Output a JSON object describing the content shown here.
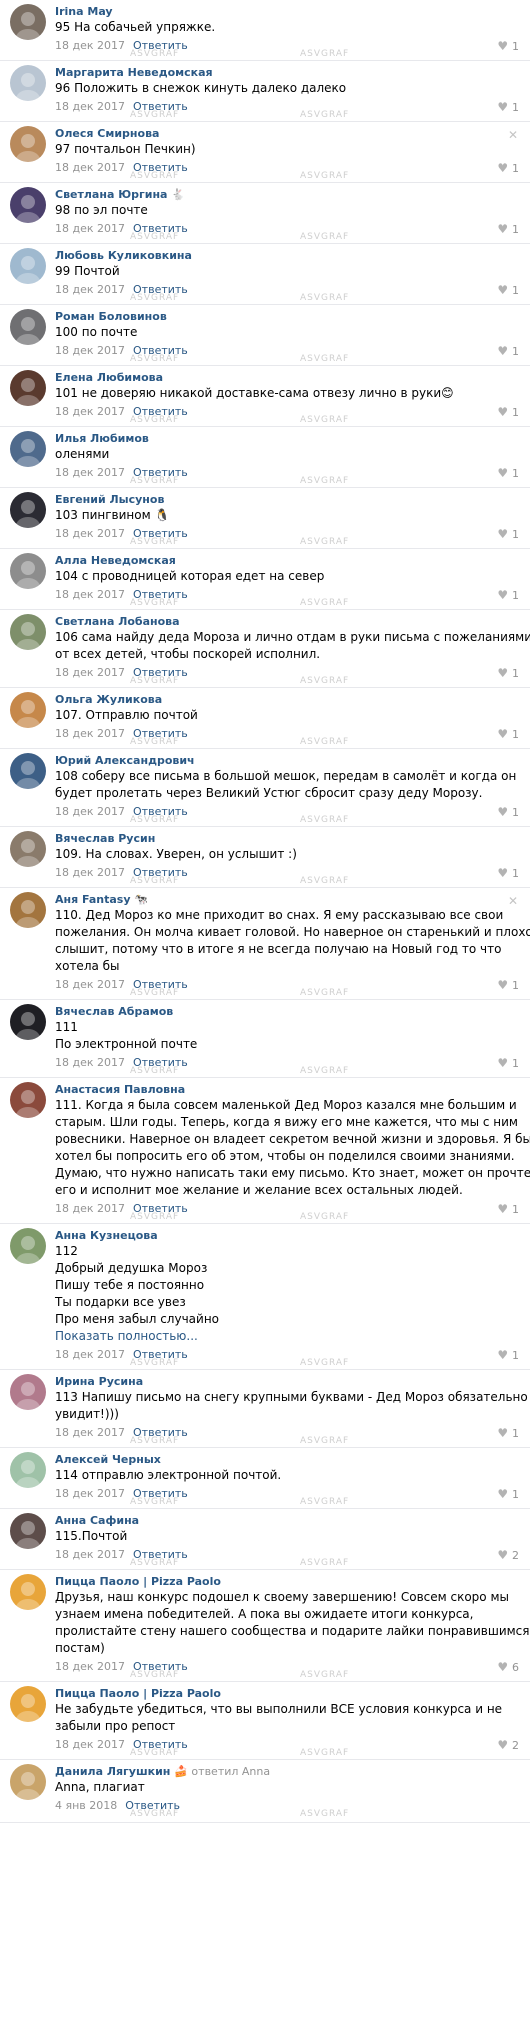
{
  "watermark": "ASVGRAF",
  "reply_label": "Ответить",
  "comments": [
    {
      "name": "Irina May",
      "lines": [
        "95 На собачьей упряжке."
      ],
      "date": "18 дек 2017",
      "likes": "1",
      "avatar": "#7a6e63"
    },
    {
      "name": "Маргарита Неведомская",
      "lines": [
        "96 Положить в снежок кинуть далеко далеко"
      ],
      "date": "18 дек 2017",
      "likes": "1",
      "avatar": "#b9c5d2"
    },
    {
      "name": "Олеся Смирнова",
      "lines": [
        "97 почтальон Печкин)"
      ],
      "date": "18 дек 2017",
      "likes": "1",
      "avatar": "#b98a5c",
      "close": true
    },
    {
      "name": "Светлана Юргина 🐇",
      "lines": [
        "98 по эл почте"
      ],
      "date": "18 дек 2017",
      "likes": "1",
      "avatar": "#4a3f6b"
    },
    {
      "name": "Любовь Куликовкина",
      "lines": [
        "99 Почтой"
      ],
      "date": "18 дек 2017",
      "likes": "1",
      "avatar": "#9fb9cf"
    },
    {
      "name": "Роман Боловинов",
      "lines": [
        "100 по почте"
      ],
      "date": "18 дек 2017",
      "likes": "1",
      "avatar": "#6f6f72"
    },
    {
      "name": "Елена Любимова",
      "lines": [
        "101 не доверяю никакой доставке-сама отвезу лично в руки😊"
      ],
      "date": "18 дек 2017",
      "likes": "1",
      "avatar": "#5a3a2e"
    },
    {
      "name": "Илья Любимов",
      "lines": [
        "оленями"
      ],
      "date": "18 дек 2017",
      "likes": "1",
      "avatar": "#4f6a8c"
    },
    {
      "name": "Евгений Лысунов",
      "lines": [
        "103 пингвином 🐧"
      ],
      "date": "18 дек 2017",
      "likes": "1",
      "avatar": "#2b2b33"
    },
    {
      "name": "Алла Неведомская",
      "lines": [
        "104 с проводницей которая едет на север"
      ],
      "date": "18 дек 2017",
      "likes": "1",
      "avatar": "#8d8d8d"
    },
    {
      "name": "Светлана Лобанова",
      "lines": [
        "106 сама найду деда Мороза и лично отдам в руки письма с пожеланиями",
        "от всех детей, чтобы поскорей исполнил."
      ],
      "date": "18 дек 2017",
      "likes": "1",
      "avatar": "#7e8f6a"
    },
    {
      "name": "Ольга Жуликова",
      "lines": [
        "107. Отправлю почтой"
      ],
      "date": "18 дек 2017",
      "likes": "1",
      "avatar": "#c6884a"
    },
    {
      "name": "Юрий Александрович",
      "lines": [
        "108 соберу все письма в большой мешок, передам в самолёт и когда он",
        "будет пролетать через Великий Устюг сбросит сразу деду Морозу."
      ],
      "date": "18 дек 2017",
      "likes": "1",
      "avatar": "#3d5f86"
    },
    {
      "name": "Вячеслав Русин",
      "lines": [
        "109. На словах. Уверен, он услышит :)"
      ],
      "date": "18 дек 2017",
      "likes": "1",
      "avatar": "#8a7b6b"
    },
    {
      "name": "Аня Fantasy 🐄",
      "lines": [
        "110. Дед Мороз ко мне приходит во снах. Я ему рассказываю все свои",
        "пожелания. Он молча кивает головой. Но наверное он старенький и плохо",
        "слышит, потому что в итоге я не всегда получаю на Новый год то что",
        "хотела бы"
      ],
      "date": "18 дек 2017",
      "likes": "1",
      "avatar": "#a3753f",
      "close": true
    },
    {
      "name": "Вячеслав Абрамов",
      "lines": [
        "111",
        "По электронной почте"
      ],
      "date": "18 дек 2017",
      "likes": "1",
      "avatar": "#1f1f24"
    },
    {
      "name": "Анастасия Павловна",
      "lines": [
        "111. Когда я была совсем маленькой Дед Мороз казался мне большим и",
        "старым. Шли годы. Теперь, когда я вижу его мне кажется, что мы с ним",
        "ровесники. Наверное он владеет секретом вечной жизни и здоровья. Я бы",
        "хотел бы попросить его об этом, чтобы он поделился своими знаниями.",
        "Думаю, что нужно написать таки ему письмо. Кто знает, может он прочтет",
        "его и исполнит мое желание и желание всех остальных людей."
      ],
      "date": "18 дек 2017",
      "likes": "1",
      "avatar": "#8b4a3c"
    },
    {
      "name": "Анна Кузнецова",
      "lines": [
        "112",
        "Добрый дедушка Мороз",
        "Пишу тебе я постоянно",
        "Ты подарки все увез",
        "Про меня забыл случайно"
      ],
      "more": "Показать полностью...",
      "date": "18 дек 2017",
      "likes": "1",
      "avatar": "#7f9a6a"
    },
    {
      "name": "Ирина Русина",
      "lines": [
        "113 Напишу письмо на снегу крупными буквами - Дед Мороз обязательно",
        "увидит!)))"
      ],
      "date": "18 дек 2017",
      "likes": "1",
      "avatar": "#b17a8c"
    },
    {
      "name": "Алексей Черных",
      "lines": [
        "114 отправлю электронной почтой."
      ],
      "date": "18 дек 2017",
      "likes": "1",
      "avatar": "#9fc2a8"
    },
    {
      "name": "Анна Сафина",
      "lines": [
        "115.Почтой"
      ],
      "date": "18 дек 2017",
      "likes": "2",
      "avatar": "#5d4d4a"
    },
    {
      "name": "Пицца Паоло | Pizza Paolo",
      "lines": [
        "Друзья, наш конкурс подошел к своему завершению! Совсем скоро мы",
        "узнаем имена победителей. А пока вы ожидаете итоги конкурса,",
        "пролистайте стену нашего сообщества и подарите лайки понравившимся",
        "постам)"
      ],
      "date": "18 дек 2017",
      "likes": "6",
      "avatar": "#e8a53a"
    },
    {
      "name": "Пицца Паоло | Pizza Paolo",
      "lines": [
        "Не забудьте убедиться, что вы выполнили ВСЕ условия конкурса и не",
        "забыли про репост"
      ],
      "date": "18 дек 2017",
      "likes": "2",
      "avatar": "#e8a53a"
    },
    {
      "name": "Данила Лягушкин 🍰",
      "name_suffix": " ответил Anna",
      "lines": [
        "Anna, плагиат"
      ],
      "date": "4 янв 2018",
      "likes": "",
      "avatar": "#c9a46a"
    }
  ]
}
